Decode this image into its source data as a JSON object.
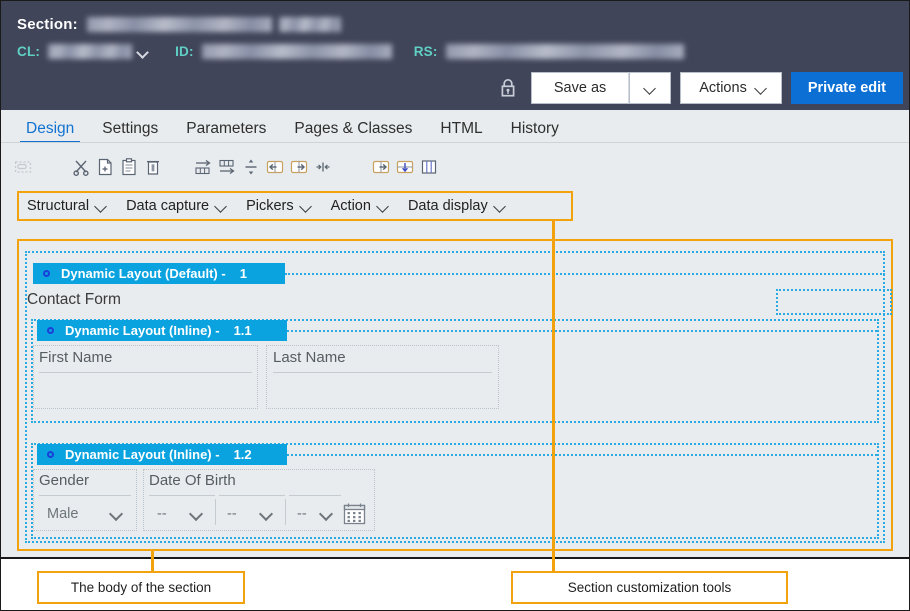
{
  "header": {
    "section_label": "Section:",
    "section_value_redacted": true,
    "cl_label": "CL:",
    "id_label": "ID:",
    "rs_label": "RS:",
    "lock_icon": "lock-icon",
    "buttons": {
      "save_as": "Save as",
      "save_as_caret": "chevron-down-icon",
      "actions": "Actions",
      "actions_caret": "chevron-down-icon",
      "private_edit": "Private edit"
    }
  },
  "tabs": [
    {
      "label": "Design",
      "active": true
    },
    {
      "label": "Settings",
      "active": false
    },
    {
      "label": "Parameters",
      "active": false
    },
    {
      "label": "Pages & Classes",
      "active": false
    },
    {
      "label": "HTML",
      "active": false
    },
    {
      "label": "History",
      "active": false
    }
  ],
  "icon_toolbar": [
    {
      "name": "select-region-icon",
      "disabled": true
    },
    {
      "name": "cut-icon",
      "disabled": false
    },
    {
      "name": "copy-new-icon",
      "disabled": false
    },
    {
      "name": "paste-icon",
      "disabled": false
    },
    {
      "name": "delete-icon",
      "disabled": false
    },
    {
      "name": "insert-row-icon",
      "disabled": false
    },
    {
      "name": "insert-column-icon",
      "disabled": false
    },
    {
      "name": "split-icon",
      "disabled": false
    },
    {
      "name": "move-left-icon",
      "disabled": false
    },
    {
      "name": "move-right-icon",
      "disabled": false
    },
    {
      "name": "merge-icon",
      "disabled": false
    },
    {
      "name": "insert-right-icon",
      "disabled": false
    },
    {
      "name": "insert-below-icon",
      "disabled": false
    },
    {
      "name": "columns-icon",
      "disabled": false
    }
  ],
  "categories": [
    {
      "label": "Structural",
      "caret": "chevron-down-icon"
    },
    {
      "label": "Data capture",
      "caret": "chevron-down-icon"
    },
    {
      "label": "Pickers",
      "caret": "chevron-down-icon"
    },
    {
      "label": "Action",
      "caret": "chevron-down-icon"
    },
    {
      "label": "Data display",
      "caret": "chevron-down-icon"
    }
  ],
  "canvas": {
    "layouts": [
      {
        "title": "Dynamic Layout (Default) -",
        "number": "1"
      },
      {
        "title": "Dynamic Layout (Inline) -",
        "number": "1.1"
      },
      {
        "title": "Dynamic Layout (Inline) -",
        "number": "1.2"
      }
    ],
    "contact_form_title": "Contact Form",
    "fields": {
      "first_name": "First Name",
      "last_name": "Last Name",
      "gender": "Gender",
      "gender_value": "Male",
      "date_of_birth": "Date Of Birth",
      "dob_day": "--",
      "dob_month": "--",
      "dob_year": "--",
      "calendar_icon": "calendar-icon"
    }
  },
  "callouts": {
    "body": "The body of the section",
    "tools": "Section customization tools"
  },
  "colors": {
    "header_bg": "#414559",
    "accent_blue": "#0aa3e0",
    "primary_button": "#0b6fd4",
    "highlight_orange": "#f2a20c",
    "teal_label": "#5fd0c4",
    "canvas_bg": "#e8ecee"
  }
}
